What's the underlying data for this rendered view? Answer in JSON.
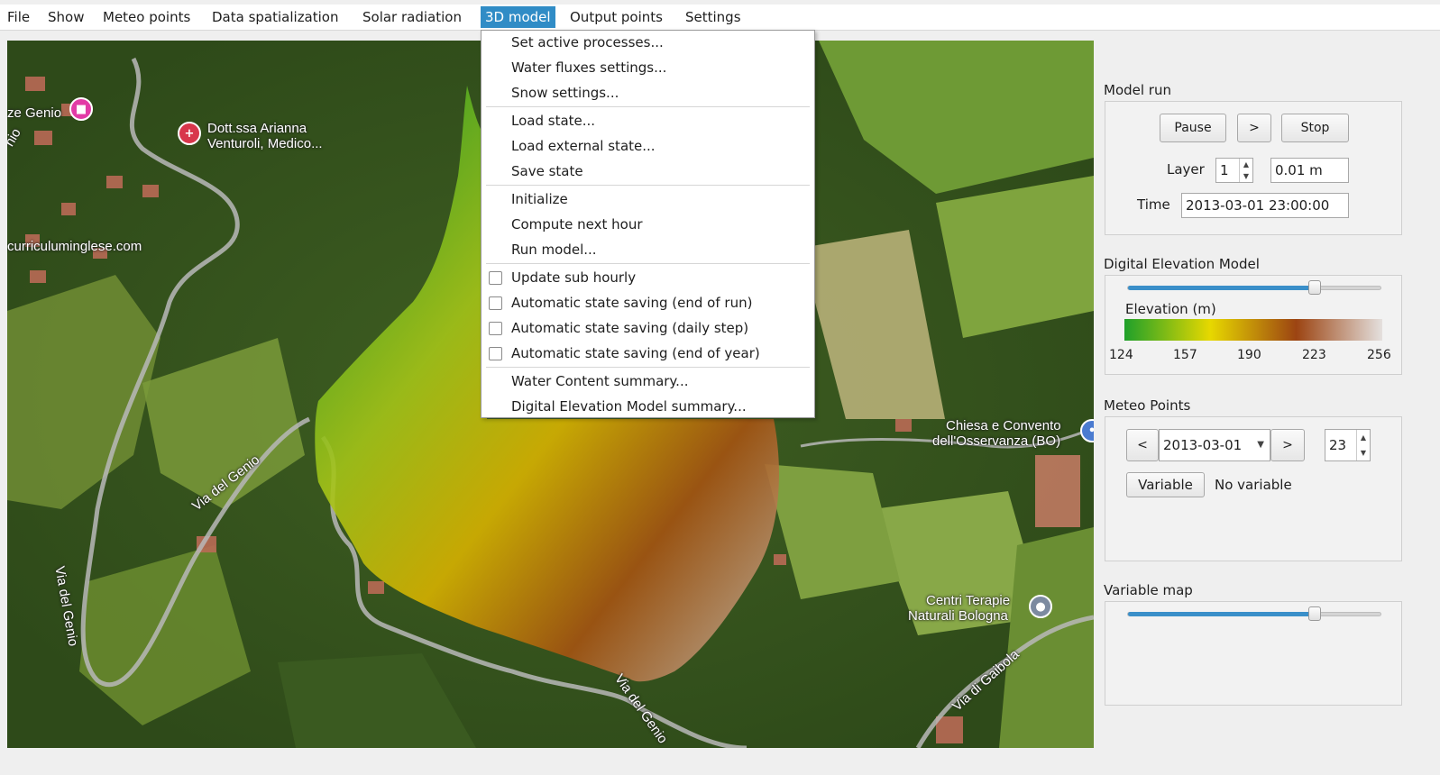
{
  "menubar": {
    "items": [
      "File",
      "Show",
      "Meteo points",
      "Data spatialization",
      "Solar radiation",
      "3D model",
      "Output points",
      "Settings"
    ],
    "active": "3D model"
  },
  "dropdown": {
    "items": [
      "Set active processes...",
      "Water fluxes settings...",
      "Snow settings...",
      "Load state...",
      "Load external state...",
      "Save state",
      "Initialize",
      "Compute next hour",
      "Run model...",
      "Update sub hourly",
      "Automatic state saving (end of run)",
      "Automatic state saving (daily step)",
      "Automatic state saving (end of year)",
      "Water Content summary...",
      "Digital Elevation Model summary..."
    ]
  },
  "map": {
    "labels": {
      "genio_top": "ze Genio",
      "dottssa_line1": "Dott.ssa Arianna",
      "dottssa_line2": "Venturoli, Medico...",
      "curriculum": "curriculuminglese.com",
      "chiesa_line1": "Chiesa e Convento",
      "chiesa_line2": "dell'Osservanza (BO)",
      "centri_line1": "Centri Terapie",
      "centri_line2": "Naturali Bologna",
      "via_genio_1": "Via del Genio",
      "via_genio_2": "Via del Genio",
      "via_genio_3": "Via del Genio",
      "via_gaibola": "Via di Gaibola",
      "partial_left": "nio"
    }
  },
  "model_run": {
    "title": "Model run",
    "pause": "Pause",
    "next": ">",
    "stop": "Stop",
    "layer_label": "Layer",
    "layer_value": "1",
    "depth_value": "0.01 m",
    "time_label": "Time",
    "time_value": "2013-03-01 23:00:00"
  },
  "dem": {
    "title": "Digital Elevation Model",
    "legend_title": "Elevation (m)",
    "ticks": [
      "124",
      "157",
      "190",
      "223",
      "256"
    ],
    "slider_fraction": 0.74,
    "colors": [
      "#1fa02a",
      "#e7d800",
      "#9c4412",
      "#e4e0de"
    ]
  },
  "meteo": {
    "title": "Meteo Points",
    "prev": "<",
    "date": "2013-03-01",
    "next": ">",
    "hour": "23",
    "variable_button": "Variable",
    "variable_value": "No variable"
  },
  "variable_map": {
    "title": "Variable map",
    "slider_fraction": 0.74
  }
}
